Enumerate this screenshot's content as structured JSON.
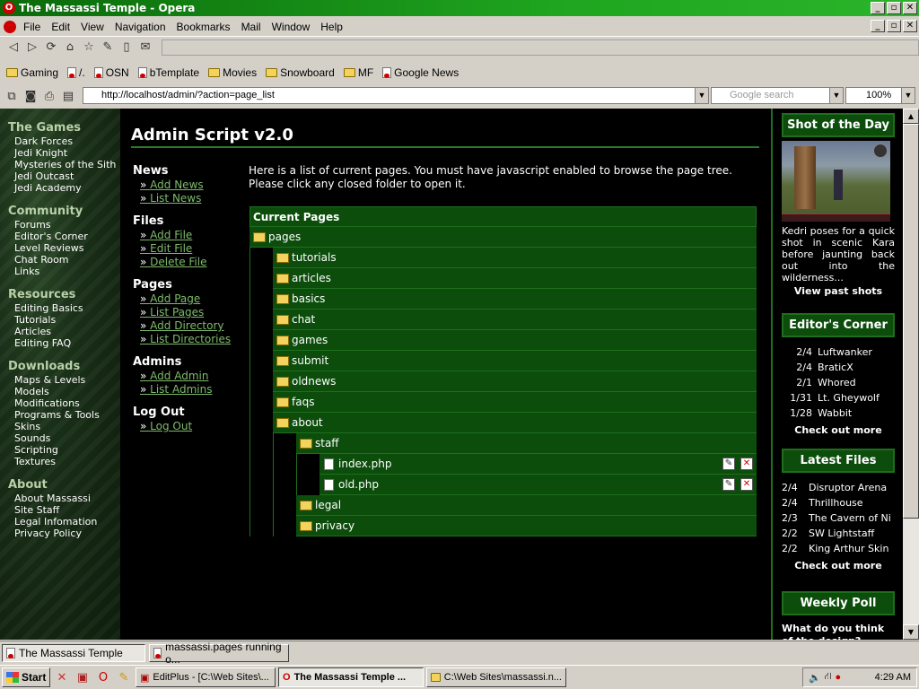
{
  "window": {
    "title": "The Massassi Temple - Opera",
    "min": "_",
    "max": "▫",
    "close": "✕"
  },
  "menu": [
    "File",
    "Edit",
    "View",
    "Navigation",
    "Bookmarks",
    "Mail",
    "Window",
    "Help"
  ],
  "bookmarks": [
    {
      "label": "Gaming",
      "icon": "folder-icon"
    },
    {
      "label": "/.",
      "icon": "page-icon"
    },
    {
      "label": "OSN",
      "icon": "page-icon"
    },
    {
      "label": "bTemplate",
      "icon": "page-icon"
    },
    {
      "label": "Movies",
      "icon": "folder-icon"
    },
    {
      "label": "Snowboard",
      "icon": "folder-icon"
    },
    {
      "label": "MF",
      "icon": "folder-icon"
    },
    {
      "label": "Google News",
      "icon": "page-icon"
    }
  ],
  "address": {
    "url": "http://localhost/admin/?action=page_list",
    "search_placeholder": "Google search",
    "zoom": "100%"
  },
  "leftnav": [
    {
      "heading": "The Games",
      "items": [
        "Dark Forces",
        "Jedi Knight",
        "Mysteries of the Sith",
        "Jedi Outcast",
        "Jedi Academy"
      ]
    },
    {
      "heading": "Community",
      "items": [
        "Forums",
        "Editor's Corner",
        "Level Reviews",
        "Chat Room",
        "Links"
      ]
    },
    {
      "heading": "Resources",
      "items": [
        "Editing Basics",
        "Tutorials",
        "Articles",
        "Editing FAQ"
      ]
    },
    {
      "heading": "Downloads",
      "items": [
        "Maps & Levels",
        "Models",
        "Modifications",
        "Programs & Tools",
        "Skins",
        "Sounds",
        "Scripting",
        "Textures"
      ]
    },
    {
      "heading": "About",
      "items": [
        "About Massassi",
        "Site Staff",
        "Legal Infomation",
        "Privacy Policy"
      ]
    }
  ],
  "main": {
    "title": "Admin Script v2.0",
    "intro": "Here is a list of current pages. You must have javascript enabled to browse the page tree. Please click any closed folder to open it.",
    "admin_menu": [
      {
        "heading": "News",
        "links": [
          "Add News",
          "List News"
        ]
      },
      {
        "heading": "Files",
        "links": [
          "Add File",
          "Edit File",
          "Delete File"
        ]
      },
      {
        "heading": "Pages",
        "links": [
          "Add Page",
          "List Pages",
          "Add Directory",
          "List Directories"
        ]
      },
      {
        "heading": "Admins",
        "links": [
          "Add Admin",
          "List Admins"
        ]
      },
      {
        "heading": "Log Out",
        "links": [
          "Log Out"
        ]
      }
    ],
    "tree_header": "Current Pages",
    "tree": {
      "root": "pages",
      "level1": [
        "tutorials",
        "articles",
        "basics",
        "chat",
        "games",
        "submit",
        "oldnews",
        "faqs",
        "about"
      ],
      "about_children": [
        "staff"
      ],
      "staff_files": [
        "index.php",
        "old.php"
      ],
      "about_after": [
        "legal",
        "privacy"
      ]
    }
  },
  "right": {
    "shot": {
      "heading": "Shot of the Day",
      "desc": "Kedri poses for a quick shot in scenic Kara before jaunting back out into the wilderness...",
      "more": "View past shots"
    },
    "editors": {
      "heading": "Editor's Corner",
      "items": [
        {
          "date": "2/4",
          "name": "Luftwanker"
        },
        {
          "date": "2/4",
          "name": "BraticX"
        },
        {
          "date": "2/1",
          "name": "Whored"
        },
        {
          "date": "1/31",
          "name": "Lt. Gheywolf"
        },
        {
          "date": "1/28",
          "name": "Wabbit"
        }
      ],
      "more": "Check out more"
    },
    "files": {
      "heading": "Latest Files",
      "items": [
        {
          "date": "2/4",
          "name": "Disruptor Arena"
        },
        {
          "date": "2/4",
          "name": "Thrillhouse"
        },
        {
          "date": "2/3",
          "name": "The Cavern of Ni"
        },
        {
          "date": "2/2",
          "name": "SW Lightstaff"
        },
        {
          "date": "2/2",
          "name": "King Arthur Skin"
        }
      ],
      "more": "Check out more"
    },
    "poll": {
      "heading": "Weekly Poll",
      "question": "What do you think of the design?"
    }
  },
  "tabs": [
    "The Massassi Temple",
    "massassi.pages running o..."
  ],
  "taskbar": {
    "start": "Start",
    "tasks": [
      "EditPlus - [C:\\Web Sites\\...",
      "The Massassi Temple ...",
      "C:\\Web Sites\\massassi.n..."
    ],
    "time": "4:29 AM"
  }
}
